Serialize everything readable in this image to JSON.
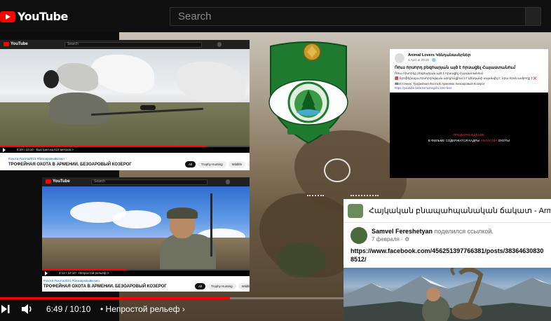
{
  "header": {
    "logo_text": "YouTube",
    "search_placeholder": "Search"
  },
  "window1": {
    "logo_text": "YouTube",
    "search_placeholder": "Search",
    "time_text": "8:29 / 10:10 · Выстрел на 617 метров >",
    "progress": 0.83,
    "hashtags": "#охота #охота2021 #безоаровыйкозел",
    "title": "ТРОФЕЙНАЯ ОХОТА В АРМЕНИИ. БЕЗОАРОВЫЙ КОЗЕРОГ",
    "chips": [
      "All",
      "Trophy Hunting",
      "Wildlife",
      "Cas"
    ]
  },
  "window2": {
    "logo_text": "YouTube",
    "search_placeholder": "Search",
    "time_text": "4:12 / 10:10 · Непростой рельеф >",
    "progress": 0.41,
    "hashtags": "#охота #охота2021 #безоаровыйкозел",
    "title": "ТРОФЕЙНАЯ ОХОТА В АРМЕНИИ. БЕЗОАРОВЫЙ КОЗЕРОГ",
    "chips": [
      "All",
      "Trophy Hunting",
      "Wildlife"
    ]
  },
  "emblem": {
    "icon": "armenian-forest-emblem-icon"
  },
  "fb_post1": {
    "author": "Animal Lovers Կենդանասերներ",
    "date": "4 April at 20:25 · 🌐",
    "title": "Ռուս որսորդ բեզոարյան այծ է որսացել Հայաստանում",
    "line1": "Ռուս որսորդը բեզոարյան այծ է որսացել Հայաստանում",
    "line2": "🟥 Տրոֆեյնայա որսորդության արդյունքում 17 կենդանի սպանվել է, նրա որսն ամբողջ է ❌",
    "line3": "📼Источник: Трофейная Охота В Армении. Безоаровый Козерог",
    "line4": "https://youtube.be/xmxmxmsgsbc See less",
    "video_text_red": "ПРЕДУПРЕЖДЕНИЕ",
    "video_text_before": "В ФИЛЬМЕ СОДЕРЖАТСЯ КАДРЫ ",
    "video_text_red2": "УБИЙСТВА",
    "video_text_after": " ОХОТЫ"
  },
  "fb_post2": {
    "group_name": "Հայկական բնապահպանական ճակատ - Armenian E",
    "author": "Samvel Fereshetyan",
    "author_action": " поделился ссылкой.",
    "date": "7 февраля · ⚙",
    "link_line1": "https://www.facebook.com/456251397766381/posts/38364630830",
    "link_line2": "8512/"
  },
  "player": {
    "time": "6:49 / 10:10",
    "chapter": "• Непростой рельеф",
    "chapter_chevron": "›",
    "progress": 0.67
  },
  "colors": {
    "youtube_red": "#ff0000",
    "emblem_green": "#1e7a2e",
    "fb_link": "#385898"
  }
}
